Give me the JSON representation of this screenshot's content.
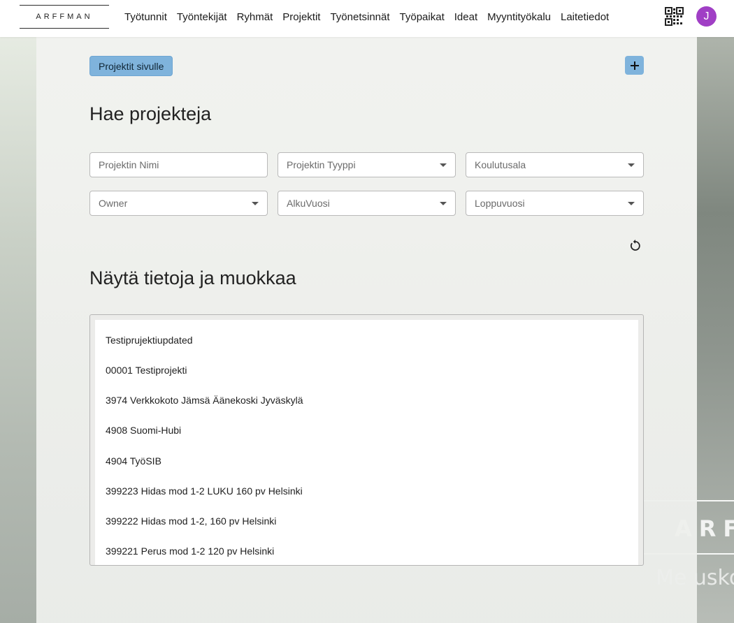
{
  "brand": {
    "logo_text": "ARFFMAN",
    "overlay_text": "ARF",
    "overlay_slogan": "Me uskon"
  },
  "nav": {
    "items": [
      "Työtunnit",
      "Työntekijät",
      "Ryhmät",
      "Projektit",
      "Työnetsinnät",
      "Työpaikat",
      "Ideat",
      "Myyntityökalu",
      "Laitetiedot"
    ],
    "avatar_initial": "J",
    "avatar_color": "#a03fc5"
  },
  "toolbar": {
    "projects_page_label": "Projektit sivulle",
    "add_label": "+"
  },
  "search": {
    "title": "Hae projekteja",
    "name_placeholder": "Projektin Nimi",
    "type_label": "Projektin Tyyppi",
    "field_label": "Koulutusala",
    "owner_label": "Owner",
    "start_year_label": "AlkuVuosi",
    "end_year_label": "Loppuvuosi"
  },
  "results": {
    "title": "Näytä tietoja ja muokkaa",
    "items": [
      "Testiprujektiupdated",
      "00001 Testiprojekti",
      "3974 Verkkokoto Jämsä Äänekoski Jyväskylä",
      "4908 Suomi-Hubi",
      "4904 TyöSIB",
      "399223 Hidas mod 1-2 LUKU 160 pv Helsinki",
      "399222 Hidas mod 1-2, 160 pv Helsinki",
      "399221 Perus mod 1-2 120 pv Helsinki"
    ]
  },
  "colors": {
    "accent": "#7fb3dc"
  }
}
